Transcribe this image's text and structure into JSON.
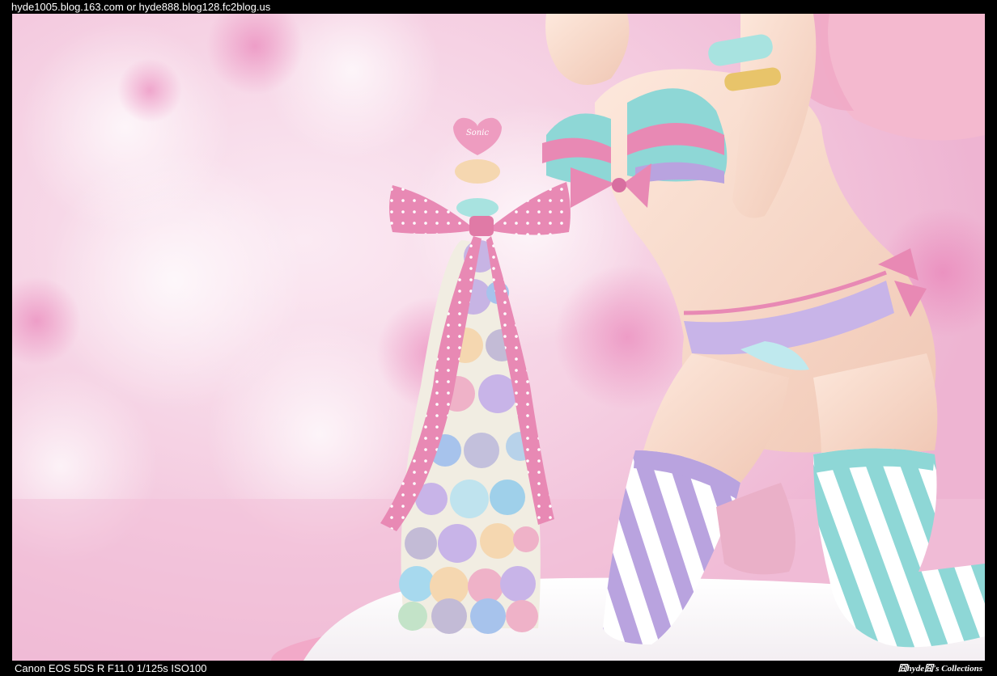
{
  "header": {
    "blog_urls": "hyde1005.blog.163.com or hyde888.blog128.fc2blog.us"
  },
  "photo": {
    "subject": "macaron-tower-figure-photo",
    "heart_topper_text": "Sonic"
  },
  "footer": {
    "camera_info": "Canon EOS 5DS R F11.0 1/125s ISO100",
    "watermark": "囧hyde囧's Collections"
  },
  "colors": {
    "frame": "#000000",
    "background_pink": "#f6d6e6",
    "ribbon_pink": "#e889b4",
    "stocking_purple": "#b9a3df",
    "stocking_teal": "#8ed7d6",
    "skin": "#f8dccd"
  }
}
